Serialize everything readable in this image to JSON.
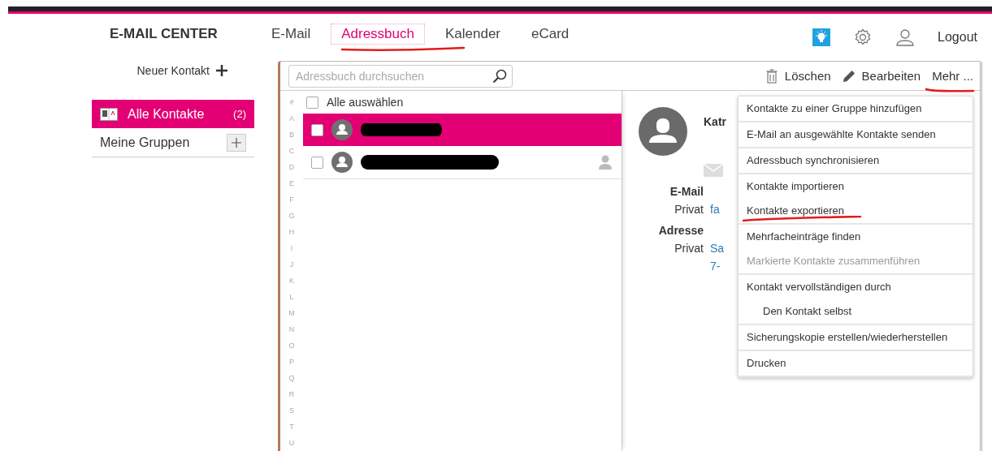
{
  "header": {
    "brand": "E-MAIL CENTER",
    "tabs": [
      {
        "label": "E-Mail",
        "selected": false
      },
      {
        "label": "Adressbuch",
        "selected": true
      },
      {
        "label": "Kalender",
        "selected": false
      },
      {
        "label": "eCard",
        "selected": false
      }
    ],
    "logout": "Logout"
  },
  "sidebar": {
    "new_contact": "Neuer Kontakt",
    "items": [
      {
        "label": "Alle Kontakte",
        "count": "(2)",
        "selected": true
      },
      {
        "label": "Meine Gruppen",
        "selected": false
      }
    ]
  },
  "toolbar": {
    "search": {
      "placeholder": "Adressbuch durchsuchen"
    },
    "actions": [
      {
        "label": "Löschen",
        "kind": "delete"
      },
      {
        "label": "Bearbeiten",
        "kind": "edit"
      },
      {
        "label": "Mehr ...",
        "kind": "more"
      }
    ]
  },
  "list": {
    "select_all": {
      "label": "Alle auswählen",
      "checked": false
    },
    "index": [
      "#",
      "A",
      "B",
      "C",
      "D",
      "E",
      "F",
      "G",
      "H",
      "I",
      "J",
      "K",
      "L",
      "M",
      "N",
      "O",
      "P",
      "Q",
      "R",
      "S",
      "T",
      "U"
    ],
    "contacts": [
      {
        "selected": true,
        "checked": false
      },
      {
        "selected": false,
        "checked": false
      }
    ]
  },
  "detail": {
    "name": "Katr",
    "sections": [
      {
        "title": "E-Mail",
        "label": "Privat",
        "value": [
          "fa"
        ]
      },
      {
        "title": "Adresse",
        "label": "Privat",
        "value": [
          "Sa",
          "7-"
        ]
      }
    ]
  },
  "menu": {
    "groups": [
      [
        {
          "label": "Kontakte zu einer Gruppe hinzufügen",
          "kind": "item",
          "disabled": false
        }
      ],
      [
        {
          "label": "E-Mail an ausgewählte Kontakte senden",
          "kind": "item",
          "disabled": false
        }
      ],
      [
        {
          "label": "Adressbuch synchronisieren",
          "kind": "item",
          "disabled": false
        }
      ],
      [
        {
          "label": "Kontakte importieren",
          "kind": "item",
          "disabled": false
        },
        {
          "label": "Kontakte exportieren",
          "kind": "item",
          "disabled": false
        }
      ],
      [
        {
          "label": "Mehrfacheinträge finden",
          "kind": "item",
          "disabled": false
        },
        {
          "label": "Markierte Kontakte zusammenführen",
          "kind": "item",
          "disabled": true
        }
      ],
      [
        {
          "label": "Kontakt vervollständigen durch",
          "kind": "item",
          "disabled": false
        },
        {
          "label": "Den Kontakt selbst",
          "kind": "subitem",
          "disabled": false
        }
      ],
      [
        {
          "label": "Sicherungskopie erstellen/wiederherstellen",
          "kind": "item",
          "disabled": false
        }
      ],
      [
        {
          "label": "Drucken",
          "kind": "item",
          "disabled": false
        }
      ]
    ]
  }
}
